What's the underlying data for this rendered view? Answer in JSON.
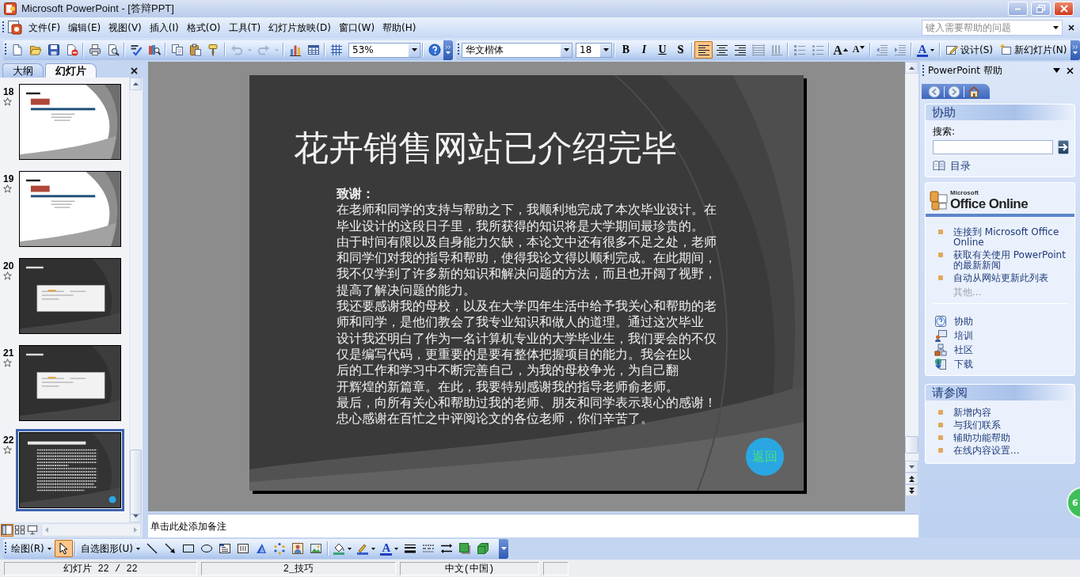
{
  "window": {
    "title": "Microsoft PowerPoint - [答辩PPT]"
  },
  "menu": [
    "文件(F)",
    "编辑(E)",
    "视图(V)",
    "插入(I)",
    "格式(O)",
    "工具(T)",
    "幻灯片放映(D)",
    "窗口(W)",
    "帮助(H)"
  ],
  "help_box": {
    "placeholder": "键入需要帮助的问题"
  },
  "standard_toolbar": {
    "undo": {
      "disabled": true
    },
    "redo": {
      "disabled": true
    },
    "zoom": "53%"
  },
  "formatting_toolbar": {
    "font": "华文楷体",
    "size": "18",
    "style_buttons": [
      "B",
      "I",
      "U",
      "S"
    ],
    "alignment": [
      {
        "selected": true
      },
      {
        "selected": false
      },
      {
        "selected": false
      }
    ],
    "font_size_buttons": [
      "A",
      "A"
    ],
    "font_color": "A",
    "design": "设计(S)",
    "new_slide": "新幻灯片(N)"
  },
  "slides_pane": {
    "tabs": [
      {
        "label": "大纲",
        "selected": false
      },
      {
        "label": "幻灯片",
        "selected": true
      }
    ],
    "thumbnails": [
      {
        "number": "18",
        "kind": "light",
        "selected": false
      },
      {
        "number": "19",
        "kind": "light",
        "selected": false
      },
      {
        "number": "20",
        "kind": "window",
        "selected": false
      },
      {
        "number": "21",
        "kind": "window",
        "selected": false
      },
      {
        "number": "22",
        "kind": "text",
        "selected": true
      }
    ]
  },
  "slide": {
    "title": "花卉销售网站已介绍完毕",
    "heading": "致谢：",
    "paragraphs": [
      [
        "在老师和同学的支持与帮助之下，我顺利地完成了本次毕业设计。在",
        "毕业设计的这段日子里，我所获得的知识将是大学期间最珍贵的。"
      ],
      [
        "由于时间有限以及自身能力欠缺，本论文中还有很多不足之处，老师",
        "和同学们对我的指导和帮助，使得我论文得以顺利完成。在此期间，",
        "我不仅学到了许多新的知识和解决问题的方法，而且也开阔了视野，",
        "提高了解决问题的能力。"
      ],
      [
        "我还要感谢我的母校，以及在大学四年生活中给予我关心和帮助的老",
        "师和同学，是他们教会了我专业知识和做人的道理。通过这次毕业",
        "设计我还明白了作为一名计算机专业的大学毕业生，我们要会的不仅",
        "仅是编写代码，更重要的是要有整体把握项目的能力。我会在以",
        "后的工作和学习中不断完善自己，为我的母校争光，为自己翻",
        "开辉煌的新篇章。在此，我要特别感谢我的指导老师俞老师。"
      ],
      [
        "最后，向所有关心和帮助过我的老师、朋友和同学表示衷心的感谢！"
      ],
      [
        "忠心感谢在百忙之中评阅论文的各位老师，你们辛苦了。"
      ]
    ],
    "back_button": "返回"
  },
  "notes": {
    "placeholder": "单击此处添加备注"
  },
  "task_pane": {
    "title": "PowerPoint 帮助",
    "assist": {
      "heading": "协助",
      "search_label": "搜索:",
      "toc_link": "目录"
    },
    "office_online": {
      "logo_caption": "Microsoft",
      "logo": "Office Online",
      "links": [
        "连接到 Microsoft Office Online",
        "获取有关使用 PowerPoint 的最新新闻",
        "自动从网站更新此列表"
      ],
      "more": {
        "label": "其他...",
        "disabled": true
      },
      "resources": [
        "协助",
        "培训",
        "社区",
        "下载"
      ]
    },
    "see_also": {
      "heading": "请参阅",
      "links": [
        "新增内容",
        "与我们联系",
        "辅助功能帮助",
        "在线内容设置..."
      ]
    }
  },
  "drawing_toolbar": {
    "draw_menu": "绘图(R)",
    "select_tool": {
      "selected": true
    },
    "autoshapes_menu": "自选图形(U)",
    "font_color": "A"
  },
  "status_bar": [
    "幻灯片 22 / 22",
    "2_技巧",
    "中文(中国)"
  ],
  "floating_badge": {
    "label": "6"
  }
}
